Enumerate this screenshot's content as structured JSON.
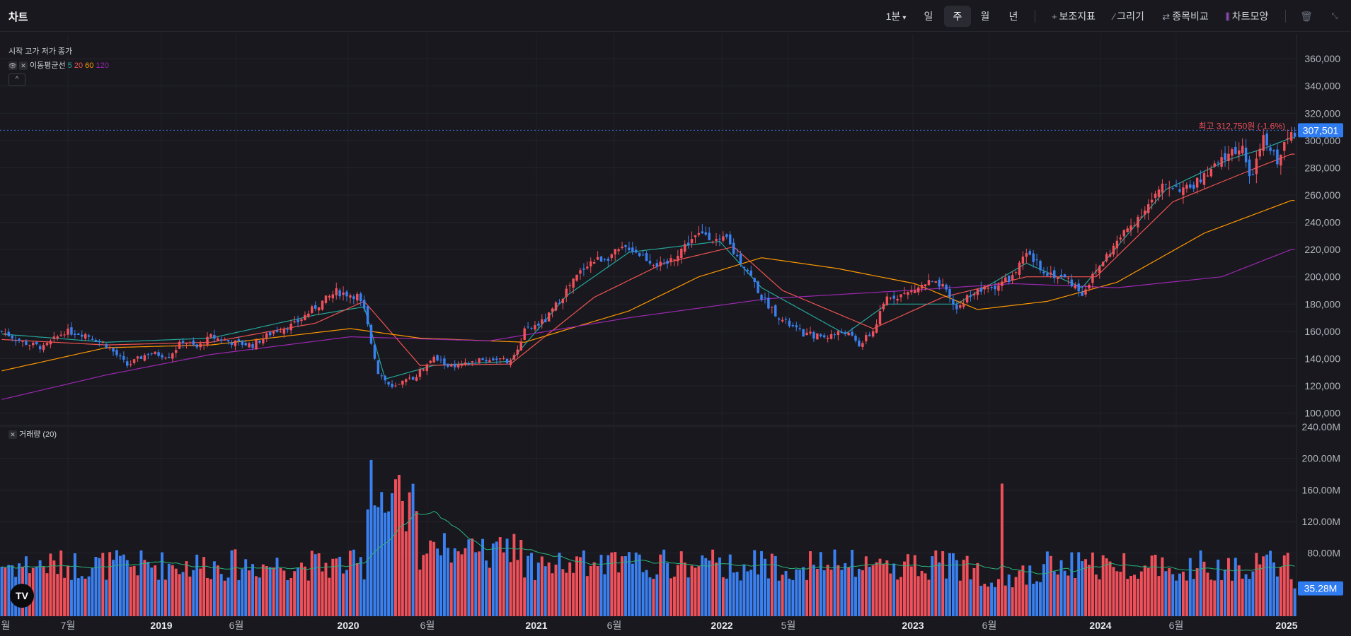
{
  "app": {
    "title": "차트"
  },
  "toolbar": {
    "interval": "1분",
    "periods": [
      "일",
      "주",
      "월",
      "년"
    ],
    "active_period": "주",
    "indicator": "보조지표",
    "draw": "그리기",
    "compare": "종목비교",
    "chart_style": "차트모양"
  },
  "legend": {
    "ohlc": "시작 고가 저가 종가",
    "ma_label": "이동평균선",
    "ma_periods": [
      "5",
      "20",
      "60",
      "120"
    ],
    "ma_colors": [
      "#26a69a",
      "#ef5350",
      "#ff9800",
      "#9c27b0"
    ],
    "volume_label": "거래량 (20)"
  },
  "annotations": {
    "high": "최고 312,750원 (-1.6%)",
    "last_price": "307,501",
    "last_volume": "35.28M"
  },
  "colors": {
    "up": "#f0505a",
    "down": "#3a80f0",
    "vol_ma": "#2bb37a",
    "accent": "#2962ff"
  },
  "chart_data": {
    "type": "candlestick",
    "x_labels": [
      "월",
      "7월",
      "2019",
      "6월",
      "2020",
      "6월",
      "2021",
      "6월",
      "2022",
      "5월",
      "2023",
      "6월",
      "2024",
      "6월",
      "2025"
    ],
    "price_axis": [
      "360,000",
      "340,000",
      "320,000",
      "300,000",
      "280,000",
      "260,000",
      "240,000",
      "220,000",
      "200,000",
      "180,000",
      "160,000",
      "140,000",
      "120,000",
      "100,000"
    ],
    "volume_axis": [
      "240.00M",
      "200.00M",
      "160.00M",
      "120.00M",
      "80.00M"
    ],
    "ylim": [
      92000,
      372000
    ],
    "volume_ylim": [
      0,
      240
    ],
    "close_path": [
      [
        0,
        160000
      ],
      [
        6,
        152000
      ],
      [
        12,
        148000
      ],
      [
        18,
        160000
      ],
      [
        24,
        158000
      ],
      [
        30,
        150000
      ],
      [
        36,
        135000
      ],
      [
        42,
        144000
      ],
      [
        48,
        142000
      ],
      [
        52,
        153000
      ],
      [
        56,
        148000
      ],
      [
        60,
        156000
      ],
      [
        66,
        152000
      ],
      [
        72,
        150000
      ],
      [
        78,
        160000
      ],
      [
        84,
        165000
      ],
      [
        90,
        178000
      ],
      [
        96,
        189000
      ],
      [
        102,
        186000
      ],
      [
        104,
        175000
      ],
      [
        108,
        130000
      ],
      [
        112,
        118000
      ],
      [
        118,
        126000
      ],
      [
        124,
        140000
      ],
      [
        130,
        133000
      ],
      [
        136,
        138000
      ],
      [
        142,
        140000
      ],
      [
        146,
        137000
      ],
      [
        150,
        160000
      ],
      [
        156,
        168000
      ],
      [
        162,
        190000
      ],
      [
        168,
        210000
      ],
      [
        174,
        215000
      ],
      [
        180,
        222000
      ],
      [
        186,
        212000
      ],
      [
        190,
        207000
      ],
      [
        194,
        218000
      ],
      [
        198,
        228000
      ],
      [
        202,
        232000
      ],
      [
        206,
        225000
      ],
      [
        208,
        228000
      ],
      [
        210,
        218000
      ],
      [
        214,
        205000
      ],
      [
        218,
        185000
      ],
      [
        224,
        168000
      ],
      [
        230,
        158000
      ],
      [
        236,
        156000
      ],
      [
        242,
        160000
      ],
      [
        246,
        150000
      ],
      [
        250,
        160000
      ],
      [
        254,
        185000
      ],
      [
        260,
        188000
      ],
      [
        266,
        196000
      ],
      [
        270,
        192000
      ],
      [
        274,
        176000
      ],
      [
        278,
        188000
      ],
      [
        284,
        192000
      ],
      [
        290,
        200000
      ],
      [
        294,
        216000
      ],
      [
        300,
        203000
      ],
      [
        306,
        198000
      ],
      [
        310,
        188000
      ],
      [
        316,
        212000
      ],
      [
        322,
        232000
      ],
      [
        328,
        250000
      ],
      [
        334,
        268000
      ],
      [
        340,
        264000
      ],
      [
        346,
        275000
      ],
      [
        352,
        290000
      ],
      [
        356,
        296000
      ],
      [
        358,
        270000
      ],
      [
        362,
        300000
      ],
      [
        366,
        286000
      ],
      [
        370,
        306000
      ]
    ],
    "ma": [
      {
        "period": "5",
        "points": [
          [
            0,
            158000
          ],
          [
            30,
            152000
          ],
          [
            60,
            155000
          ],
          [
            90,
            172000
          ],
          [
            104,
            178000
          ],
          [
            110,
            125000
          ],
          [
            124,
            135000
          ],
          [
            146,
            138000
          ],
          [
            162,
            186000
          ],
          [
            180,
            218000
          ],
          [
            206,
            226000
          ],
          [
            218,
            192000
          ],
          [
            242,
            158000
          ],
          [
            254,
            180000
          ],
          [
            274,
            180000
          ],
          [
            294,
            210000
          ],
          [
            310,
            192000
          ],
          [
            334,
            264000
          ],
          [
            352,
            286000
          ],
          [
            362,
            294000
          ],
          [
            370,
            302000
          ]
        ]
      },
      {
        "period": "20",
        "points": [
          [
            0,
            154000
          ],
          [
            30,
            150000
          ],
          [
            60,
            152000
          ],
          [
            90,
            166000
          ],
          [
            104,
            182000
          ],
          [
            120,
            135000
          ],
          [
            146,
            136000
          ],
          [
            170,
            185000
          ],
          [
            190,
            210000
          ],
          [
            210,
            222000
          ],
          [
            224,
            190000
          ],
          [
            250,
            162000
          ],
          [
            270,
            185000
          ],
          [
            294,
            200000
          ],
          [
            314,
            200000
          ],
          [
            336,
            255000
          ],
          [
            360,
            280000
          ],
          [
            370,
            290000
          ]
        ]
      },
      {
        "period": "60",
        "points": [
          [
            0,
            131000
          ],
          [
            30,
            148000
          ],
          [
            60,
            150000
          ],
          [
            100,
            162000
          ],
          [
            120,
            155000
          ],
          [
            150,
            152000
          ],
          [
            180,
            175000
          ],
          [
            200,
            200000
          ],
          [
            218,
            214000
          ],
          [
            240,
            206000
          ],
          [
            262,
            195000
          ],
          [
            280,
            176000
          ],
          [
            300,
            182000
          ],
          [
            320,
            196000
          ],
          [
            345,
            232000
          ],
          [
            370,
            256000
          ]
        ]
      },
      {
        "period": "120",
        "points": [
          [
            0,
            110000
          ],
          [
            30,
            128000
          ],
          [
            60,
            143000
          ],
          [
            100,
            156000
          ],
          [
            140,
            153000
          ],
          [
            180,
            170000
          ],
          [
            220,
            184000
          ],
          [
            260,
            190000
          ],
          [
            290,
            195000
          ],
          [
            320,
            192000
          ],
          [
            350,
            200000
          ],
          [
            370,
            220000
          ]
        ]
      }
    ],
    "volume": {
      "ma_value_last": 35.28,
      "unit": "M"
    }
  }
}
